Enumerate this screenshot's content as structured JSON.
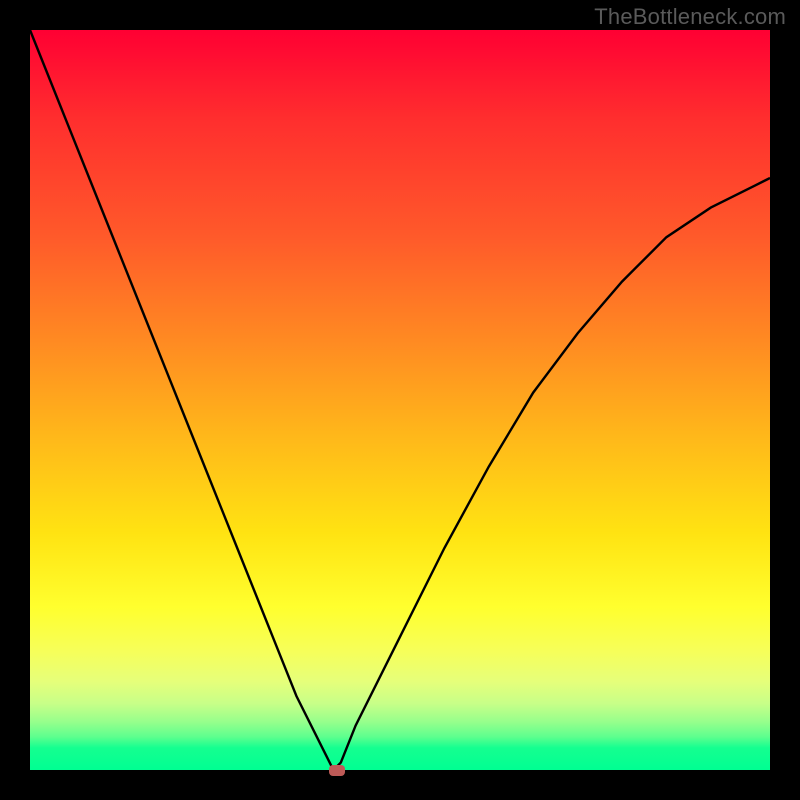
{
  "watermark": "TheBottleneck.com",
  "chart_data": {
    "type": "line",
    "title": "",
    "xlabel": "",
    "ylabel": "",
    "x_range": [
      0,
      1
    ],
    "y_range": [
      0,
      1
    ],
    "grid": false,
    "series": [
      {
        "name": "curve",
        "x": [
          0.0,
          0.04,
          0.08,
          0.12,
          0.16,
          0.2,
          0.24,
          0.28,
          0.32,
          0.36,
          0.4,
          0.41,
          0.42,
          0.44,
          0.5,
          0.56,
          0.62,
          0.68,
          0.74,
          0.8,
          0.86,
          0.92,
          0.98,
          1.0
        ],
        "values": [
          1.0,
          0.9,
          0.8,
          0.7,
          0.6,
          0.5,
          0.4,
          0.3,
          0.2,
          0.1,
          0.02,
          0.0,
          0.01,
          0.06,
          0.18,
          0.3,
          0.41,
          0.51,
          0.59,
          0.66,
          0.72,
          0.76,
          0.79,
          0.8
        ]
      }
    ],
    "marker": {
      "x": 0.415,
      "y": 0.0
    }
  }
}
